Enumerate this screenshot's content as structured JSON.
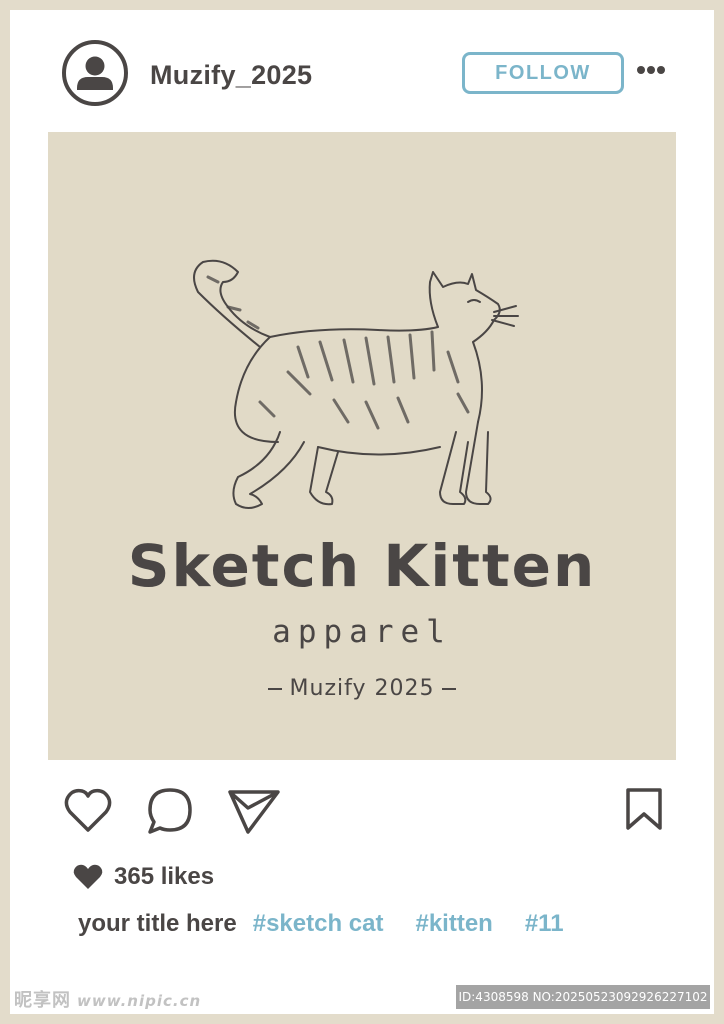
{
  "post": {
    "username": "Muzify_2025",
    "follow_label": "FOLLOW",
    "image": {
      "brand_title": "Sketch Kitten",
      "brand_subtitle": "apparel",
      "brand_credit": "Muzify 2025",
      "background_color": "#e1dac7"
    },
    "likes_label": "365 likes",
    "caption_title": "your title here",
    "hashtags": [
      "#sketch cat",
      "#kitten",
      "#11"
    ]
  },
  "colors": {
    "accent": "#7bb5ca",
    "ink": "#4a4645",
    "frame": "#e3dccb"
  },
  "icons": {
    "avatar": "user-avatar-icon",
    "more": "more-options-icon",
    "like": "heart-icon",
    "comment": "comment-icon",
    "share": "send-icon",
    "save": "bookmark-icon",
    "likes_heart": "filled-heart-icon"
  },
  "watermark": {
    "site": "昵享网",
    "url": "www.nipic.cn",
    "id_text": "ID:4308598 NO:20250523092926227102"
  }
}
